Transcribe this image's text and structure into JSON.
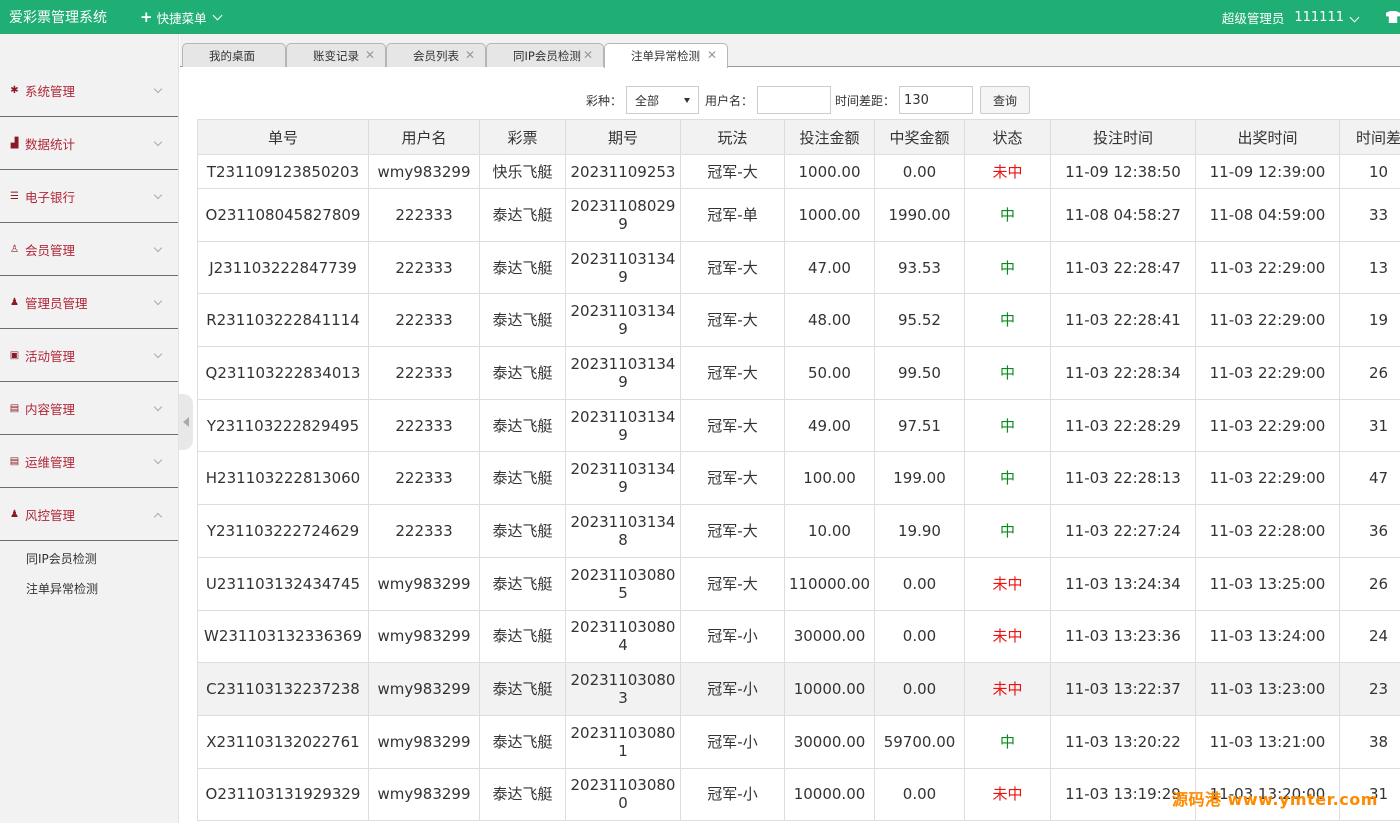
{
  "app": {
    "title": "爱彩票管理系统",
    "quick_menu": "快捷菜单",
    "role": "超级管理员",
    "username": "111111"
  },
  "sidebar": {
    "items": [
      {
        "label": "系统管理",
        "icon": "gear-icon"
      },
      {
        "label": "数据统计",
        "icon": "bar-chart-icon"
      },
      {
        "label": "电子银行",
        "icon": "list-icon"
      },
      {
        "label": "会员管理",
        "icon": "user-icon"
      },
      {
        "label": "管理员管理",
        "icon": "admin-user-icon"
      },
      {
        "label": "活动管理",
        "icon": "gift-icon"
      },
      {
        "label": "内容管理",
        "icon": "document-icon"
      },
      {
        "label": "运维管理",
        "icon": "document-icon"
      },
      {
        "label": "风控管理",
        "icon": "admin-user-icon"
      }
    ],
    "sub_items": [
      "同IP会员检测",
      "注单异常检测"
    ]
  },
  "tabs": [
    {
      "label": "我的桌面"
    },
    {
      "label": "账变记录"
    },
    {
      "label": "会员列表"
    },
    {
      "label": "同IP会员检测"
    },
    {
      "label": "注单异常检测"
    }
  ],
  "search": {
    "lottery_label": "彩种：",
    "lottery_value": "全部",
    "user_label": "用户名：",
    "user_value": "",
    "gap_label": "时间差距：",
    "gap_value": "130",
    "button": "查询"
  },
  "table": {
    "headers": [
      "单号",
      "用户名",
      "彩票",
      "期号",
      "玩法",
      "投注金额",
      "中奖金额",
      "状态",
      "投注时间",
      "出奖时间",
      "时间差"
    ],
    "rows": [
      [
        "T231109123850203",
        "wmy983299",
        "快乐飞艇",
        "20231109253",
        "冠军-大",
        "1000.00",
        "0.00",
        "未中",
        "11-09 12:38:50",
        "11-09 12:39:00",
        "10"
      ],
      [
        "O231108045827809",
        "222333",
        "泰达飞艇",
        "202311080299",
        "冠军-单",
        "1000.00",
        "1990.00",
        "中",
        "11-08 04:58:27",
        "11-08 04:59:00",
        "33"
      ],
      [
        "J231103222847739",
        "222333",
        "泰达飞艇",
        "202311031349",
        "冠军-大",
        "47.00",
        "93.53",
        "中",
        "11-03 22:28:47",
        "11-03 22:29:00",
        "13"
      ],
      [
        "R231103222841114",
        "222333",
        "泰达飞艇",
        "202311031349",
        "冠军-大",
        "48.00",
        "95.52",
        "中",
        "11-03 22:28:41",
        "11-03 22:29:00",
        "19"
      ],
      [
        "Q231103222834013",
        "222333",
        "泰达飞艇",
        "202311031349",
        "冠军-大",
        "50.00",
        "99.50",
        "中",
        "11-03 22:28:34",
        "11-03 22:29:00",
        "26"
      ],
      [
        "Y231103222829495",
        "222333",
        "泰达飞艇",
        "202311031349",
        "冠军-大",
        "49.00",
        "97.51",
        "中",
        "11-03 22:28:29",
        "11-03 22:29:00",
        "31"
      ],
      [
        "H231103222813060",
        "222333",
        "泰达飞艇",
        "202311031349",
        "冠军-大",
        "100.00",
        "199.00",
        "中",
        "11-03 22:28:13",
        "11-03 22:29:00",
        "47"
      ],
      [
        "Y231103222724629",
        "222333",
        "泰达飞艇",
        "202311031348",
        "冠军-大",
        "10.00",
        "19.90",
        "中",
        "11-03 22:27:24",
        "11-03 22:28:00",
        "36"
      ],
      [
        "U231103132434745",
        "wmy983299",
        "泰达飞艇",
        "202311030805",
        "冠军-大",
        "110000.00",
        "0.00",
        "未中",
        "11-03 13:24:34",
        "11-03 13:25:00",
        "26"
      ],
      [
        "W231103132336369",
        "wmy983299",
        "泰达飞艇",
        "202311030804",
        "冠军-小",
        "30000.00",
        "0.00",
        "未中",
        "11-03 13:23:36",
        "11-03 13:24:00",
        "24"
      ],
      [
        "C231103132237238",
        "wmy983299",
        "泰达飞艇",
        "202311030803",
        "冠军-小",
        "10000.00",
        "0.00",
        "未中",
        "11-03 13:22:37",
        "11-03 13:23:00",
        "23"
      ],
      [
        "X231103132022761",
        "wmy983299",
        "泰达飞艇",
        "202311030801",
        "冠军-小",
        "30000.00",
        "59700.00",
        "中",
        "11-03 13:20:22",
        "11-03 13:21:00",
        "38"
      ],
      [
        "O231103131929329",
        "wmy983299",
        "泰达飞艇",
        "202311030800",
        "冠军-小",
        "10000.00",
        "0.00",
        "未中",
        "11-03 13:19:29",
        "11-03 13:20:00",
        "31"
      ]
    ]
  },
  "watermark": "源码港 www.ymter.com",
  "colors": {
    "topbar": "#1fae74",
    "win": "#0a8a1a",
    "lose": "#ee1111",
    "sidebar_text": "#b0263a"
  }
}
